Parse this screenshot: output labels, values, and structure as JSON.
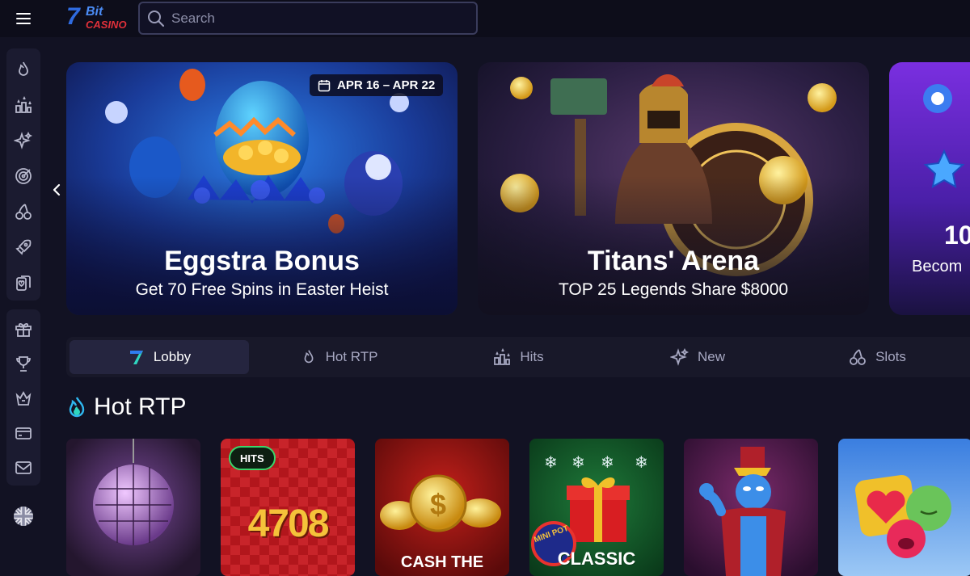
{
  "header": {
    "menu_icon": "hamburger-menu-icon",
    "logo_text": {
      "seven": "7",
      "bit": "Bit",
      "casino": "CASINO"
    },
    "search": {
      "placeholder": "Search",
      "value": "",
      "icon": "search-icon"
    }
  },
  "sidebar": {
    "group1": [
      {
        "icon": "flame-icon"
      },
      {
        "icon": "hits-icon"
      },
      {
        "icon": "sparkle-icon"
      },
      {
        "icon": "target-icon"
      },
      {
        "icon": "cherries-icon"
      },
      {
        "icon": "rocket-icon"
      },
      {
        "icon": "cards-icon"
      }
    ],
    "group2": [
      {
        "icon": "gift-icon"
      },
      {
        "icon": "trophy-icon"
      },
      {
        "icon": "crown-icon"
      },
      {
        "icon": "card-icon"
      },
      {
        "icon": "mail-icon"
      }
    ],
    "language_icon": "uk-flag-icon"
  },
  "banners": [
    {
      "title": "Eggstra Bonus",
      "subtitle": "Get 70 Free Spins in Easter Heist",
      "date": "APR 16 – APR 22"
    },
    {
      "title": "Titans' Arena",
      "subtitle": "TOP 25 Legends Share $8000"
    },
    {
      "title": "10",
      "subtitle": "Becom"
    }
  ],
  "tabs": [
    {
      "label": "Lobby",
      "icon": "seven-logo-icon",
      "active": true
    },
    {
      "label": "Hot RTP",
      "icon": "flame-icon",
      "active": false
    },
    {
      "label": "Hits",
      "icon": "hits-icon",
      "active": false
    },
    {
      "label": "New",
      "icon": "sparkle-icon",
      "active": false
    },
    {
      "label": "Slots",
      "icon": "cherries-icon",
      "active": false
    }
  ],
  "section": {
    "title": "Hot RTP",
    "icon": "blue-flame-icon"
  },
  "games": [
    {
      "name": "disco ball game"
    },
    {
      "badge": "HITS",
      "art_text": "4708"
    },
    {
      "art_text": "CASH THE"
    },
    {
      "art_text": "CLASSIC",
      "sub_text": "MINI POT"
    },
    {
      "name": "genie game"
    },
    {
      "name": "fruit faces game"
    }
  ],
  "colors": {
    "background": "#121223",
    "sidebar": "#1b1b30",
    "accent_green": "#3ad66b",
    "accent_blue": "#4b8cf5"
  }
}
